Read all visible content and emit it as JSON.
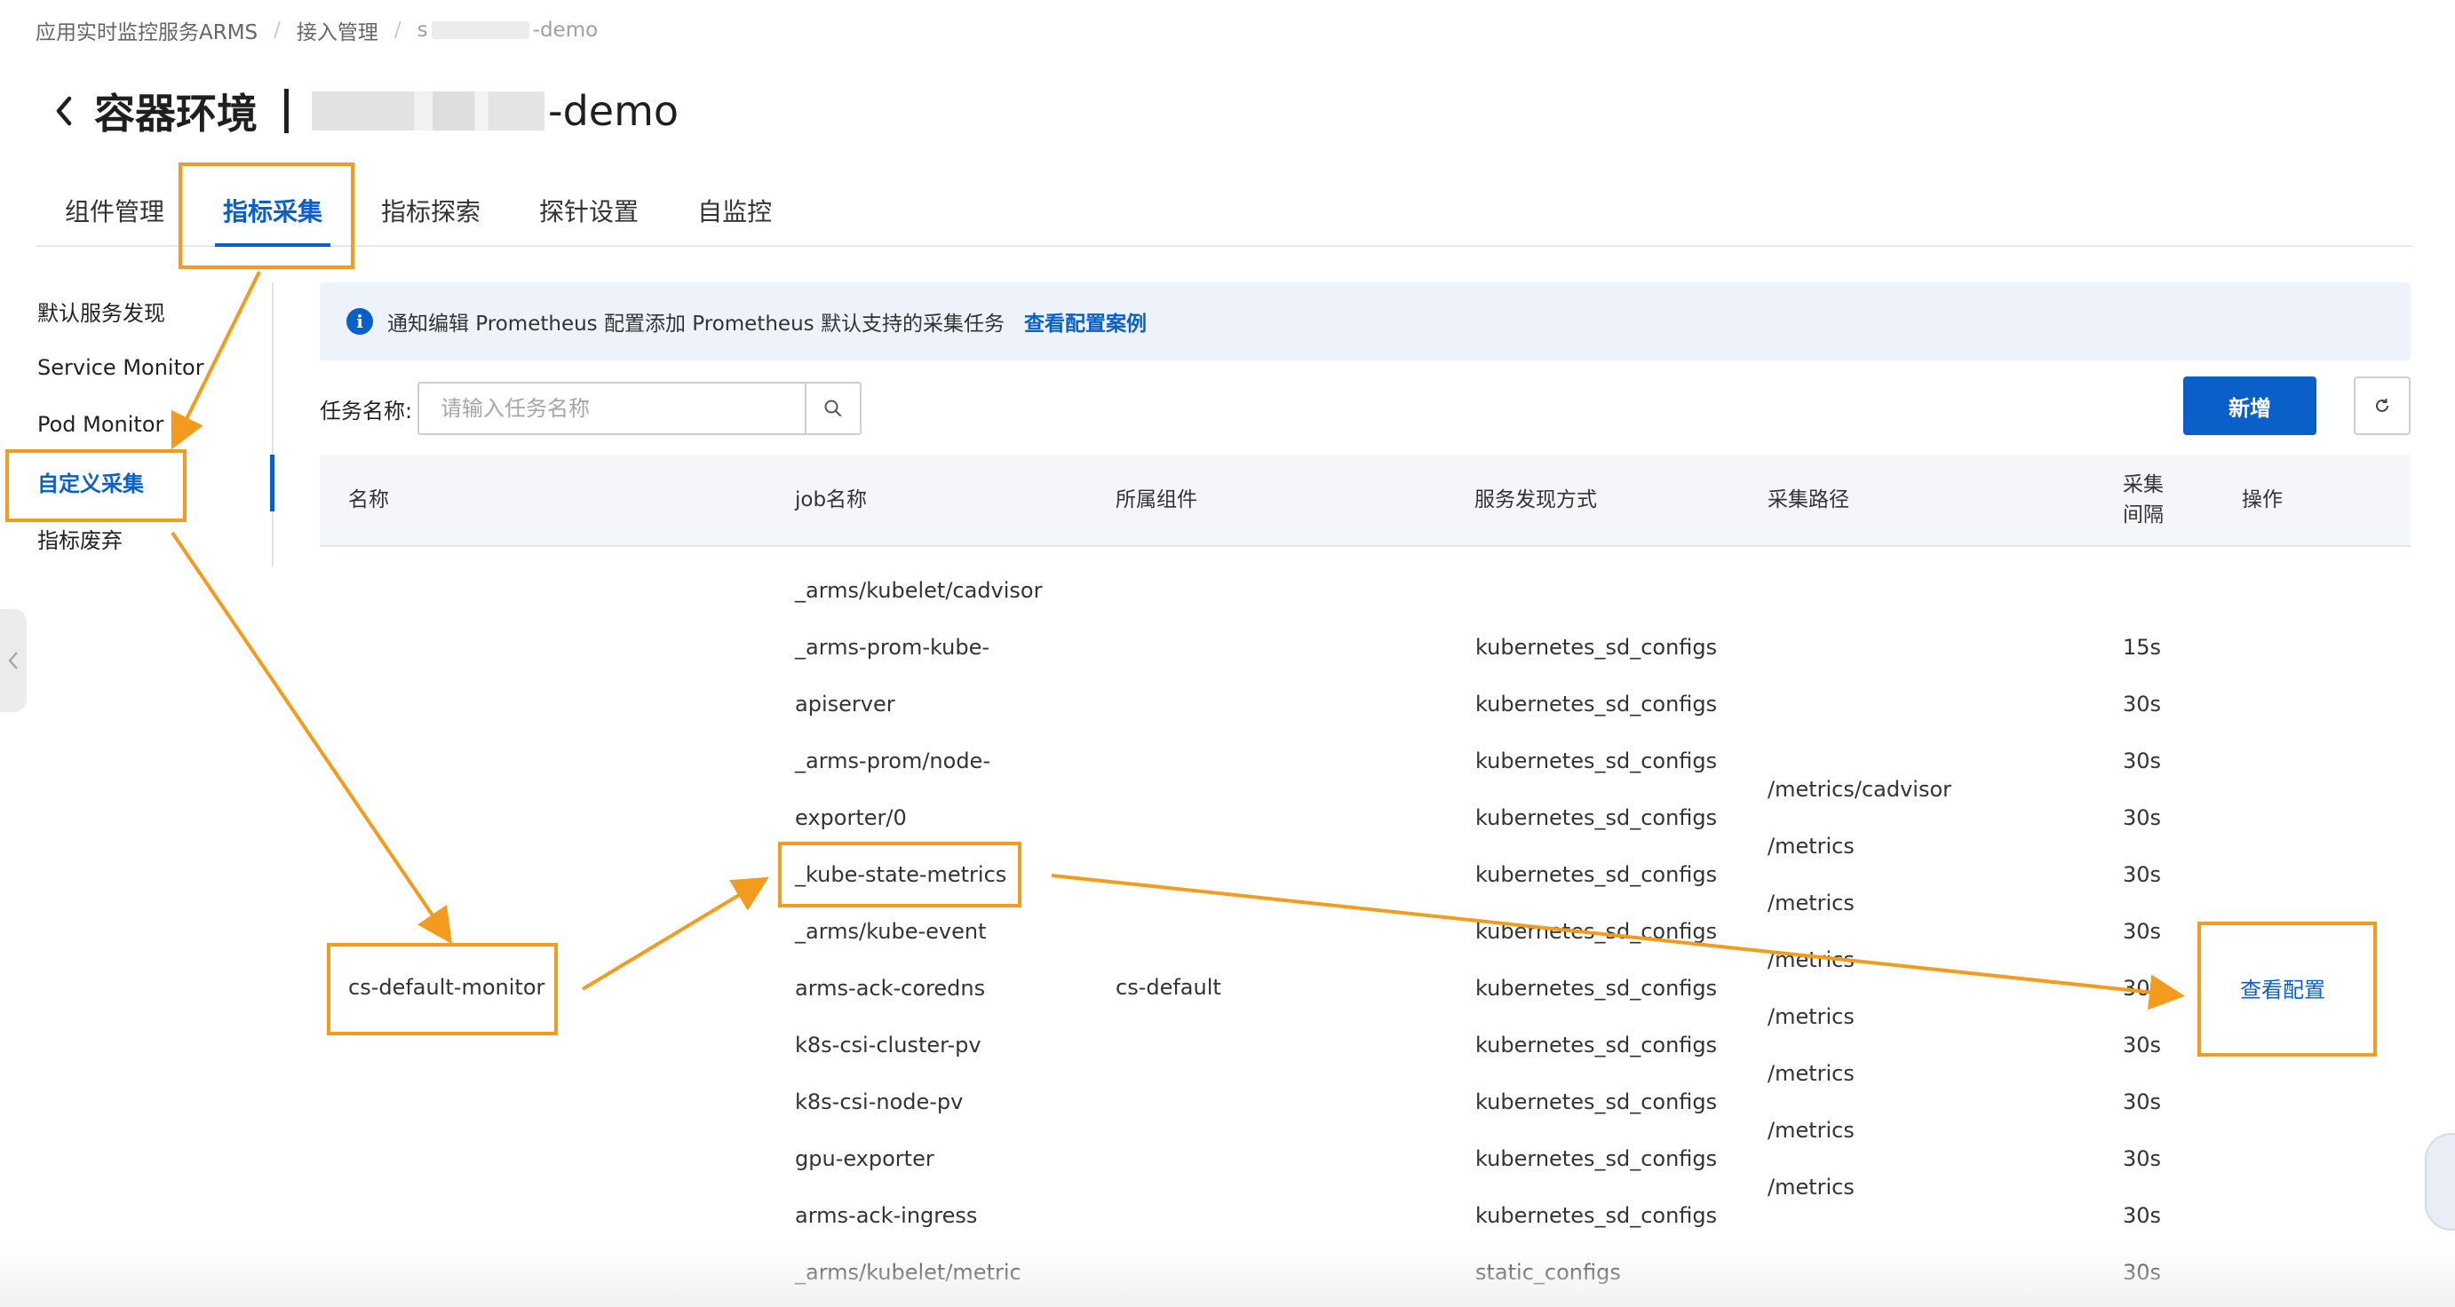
{
  "breadcrumb": {
    "root": "应用实时监控服务ARMS",
    "sep": "/",
    "second": "接入管理",
    "third_prefix": "s",
    "third_suffix": "-demo"
  },
  "header": {
    "back_icon": "chevron-left-icon",
    "title": "容器环境",
    "app_name_suffix": "-demo"
  },
  "tabs": [
    {
      "label": "组件管理",
      "active": false
    },
    {
      "label": "指标采集",
      "active": true
    },
    {
      "label": "指标探索",
      "active": false
    },
    {
      "label": "探针设置",
      "active": false
    },
    {
      "label": "自监控",
      "active": false
    }
  ],
  "sidenav": [
    {
      "label": "默认服务发现",
      "active": false
    },
    {
      "label": "Service Monitor",
      "active": false
    },
    {
      "label": "Pod Monitor",
      "active": false
    },
    {
      "label": "自定义采集",
      "active": true
    },
    {
      "label": "指标废弃",
      "active": false
    }
  ],
  "banner": {
    "icon": "info-icon",
    "text": "通知编辑 Prometheus 配置添加 Prometheus 默认支持的采集任务",
    "link": "查看配置案例"
  },
  "search": {
    "label": "任务名称:",
    "placeholder": "请输入任务名称",
    "icon": "search-icon"
  },
  "toolbar": {
    "add_label": "新增",
    "refresh_icon": "refresh-icon"
  },
  "table": {
    "headers": {
      "name": "名称",
      "job": "job名称",
      "component": "所属组件",
      "discovery": "服务发现方式",
      "path": "采集路径",
      "interval_1": "采集",
      "interval_2": "间隔",
      "action": "操作"
    },
    "group": {
      "name": "cs-default-monitor",
      "component": "cs-default",
      "action": "查看配置"
    },
    "jobs": [
      {
        "job": "_arms/kubelet/cadvisor",
        "discovery": "",
        "interval": ""
      },
      {
        "job": "_arms-prom-kube-",
        "discovery": "kubernetes_sd_configs",
        "interval": "15s"
      },
      {
        "job": "apiserver",
        "discovery": "kubernetes_sd_configs",
        "interval": "30s"
      },
      {
        "job": "_arms-prom/node-",
        "discovery": "kubernetes_sd_configs",
        "interval": "30s"
      },
      {
        "job": "exporter/0",
        "discovery": "kubernetes_sd_configs",
        "interval": "30s"
      },
      {
        "job": "_kube-state-metrics",
        "discovery": "kubernetes_sd_configs",
        "interval": "30s"
      },
      {
        "job": "_arms/kube-event",
        "discovery": "kubernetes_sd_configs",
        "interval": "30s"
      },
      {
        "job": "arms-ack-coredns",
        "discovery": "kubernetes_sd_configs",
        "interval": "30s"
      },
      {
        "job": "k8s-csi-cluster-pv",
        "discovery": "kubernetes_sd_configs",
        "interval": "30s"
      },
      {
        "job": "k8s-csi-node-pv",
        "discovery": "kubernetes_sd_configs",
        "interval": "30s"
      },
      {
        "job": "gpu-exporter",
        "discovery": "kubernetes_sd_configs",
        "interval": "30s"
      },
      {
        "job": "arms-ack-ingress",
        "discovery": "kubernetes_sd_configs",
        "interval": "30s"
      },
      {
        "job": "_arms/kubelet/metric",
        "discovery": "static_configs",
        "interval": "30s"
      }
    ],
    "paths": [
      "/metrics/cadvisor",
      "/metrics",
      "/metrics",
      "/metrics",
      "/metrics",
      "/metrics",
      "/metrics",
      "/metrics"
    ]
  },
  "annotation_color": "#f29b1d",
  "accent_color": "#0b5fc8"
}
